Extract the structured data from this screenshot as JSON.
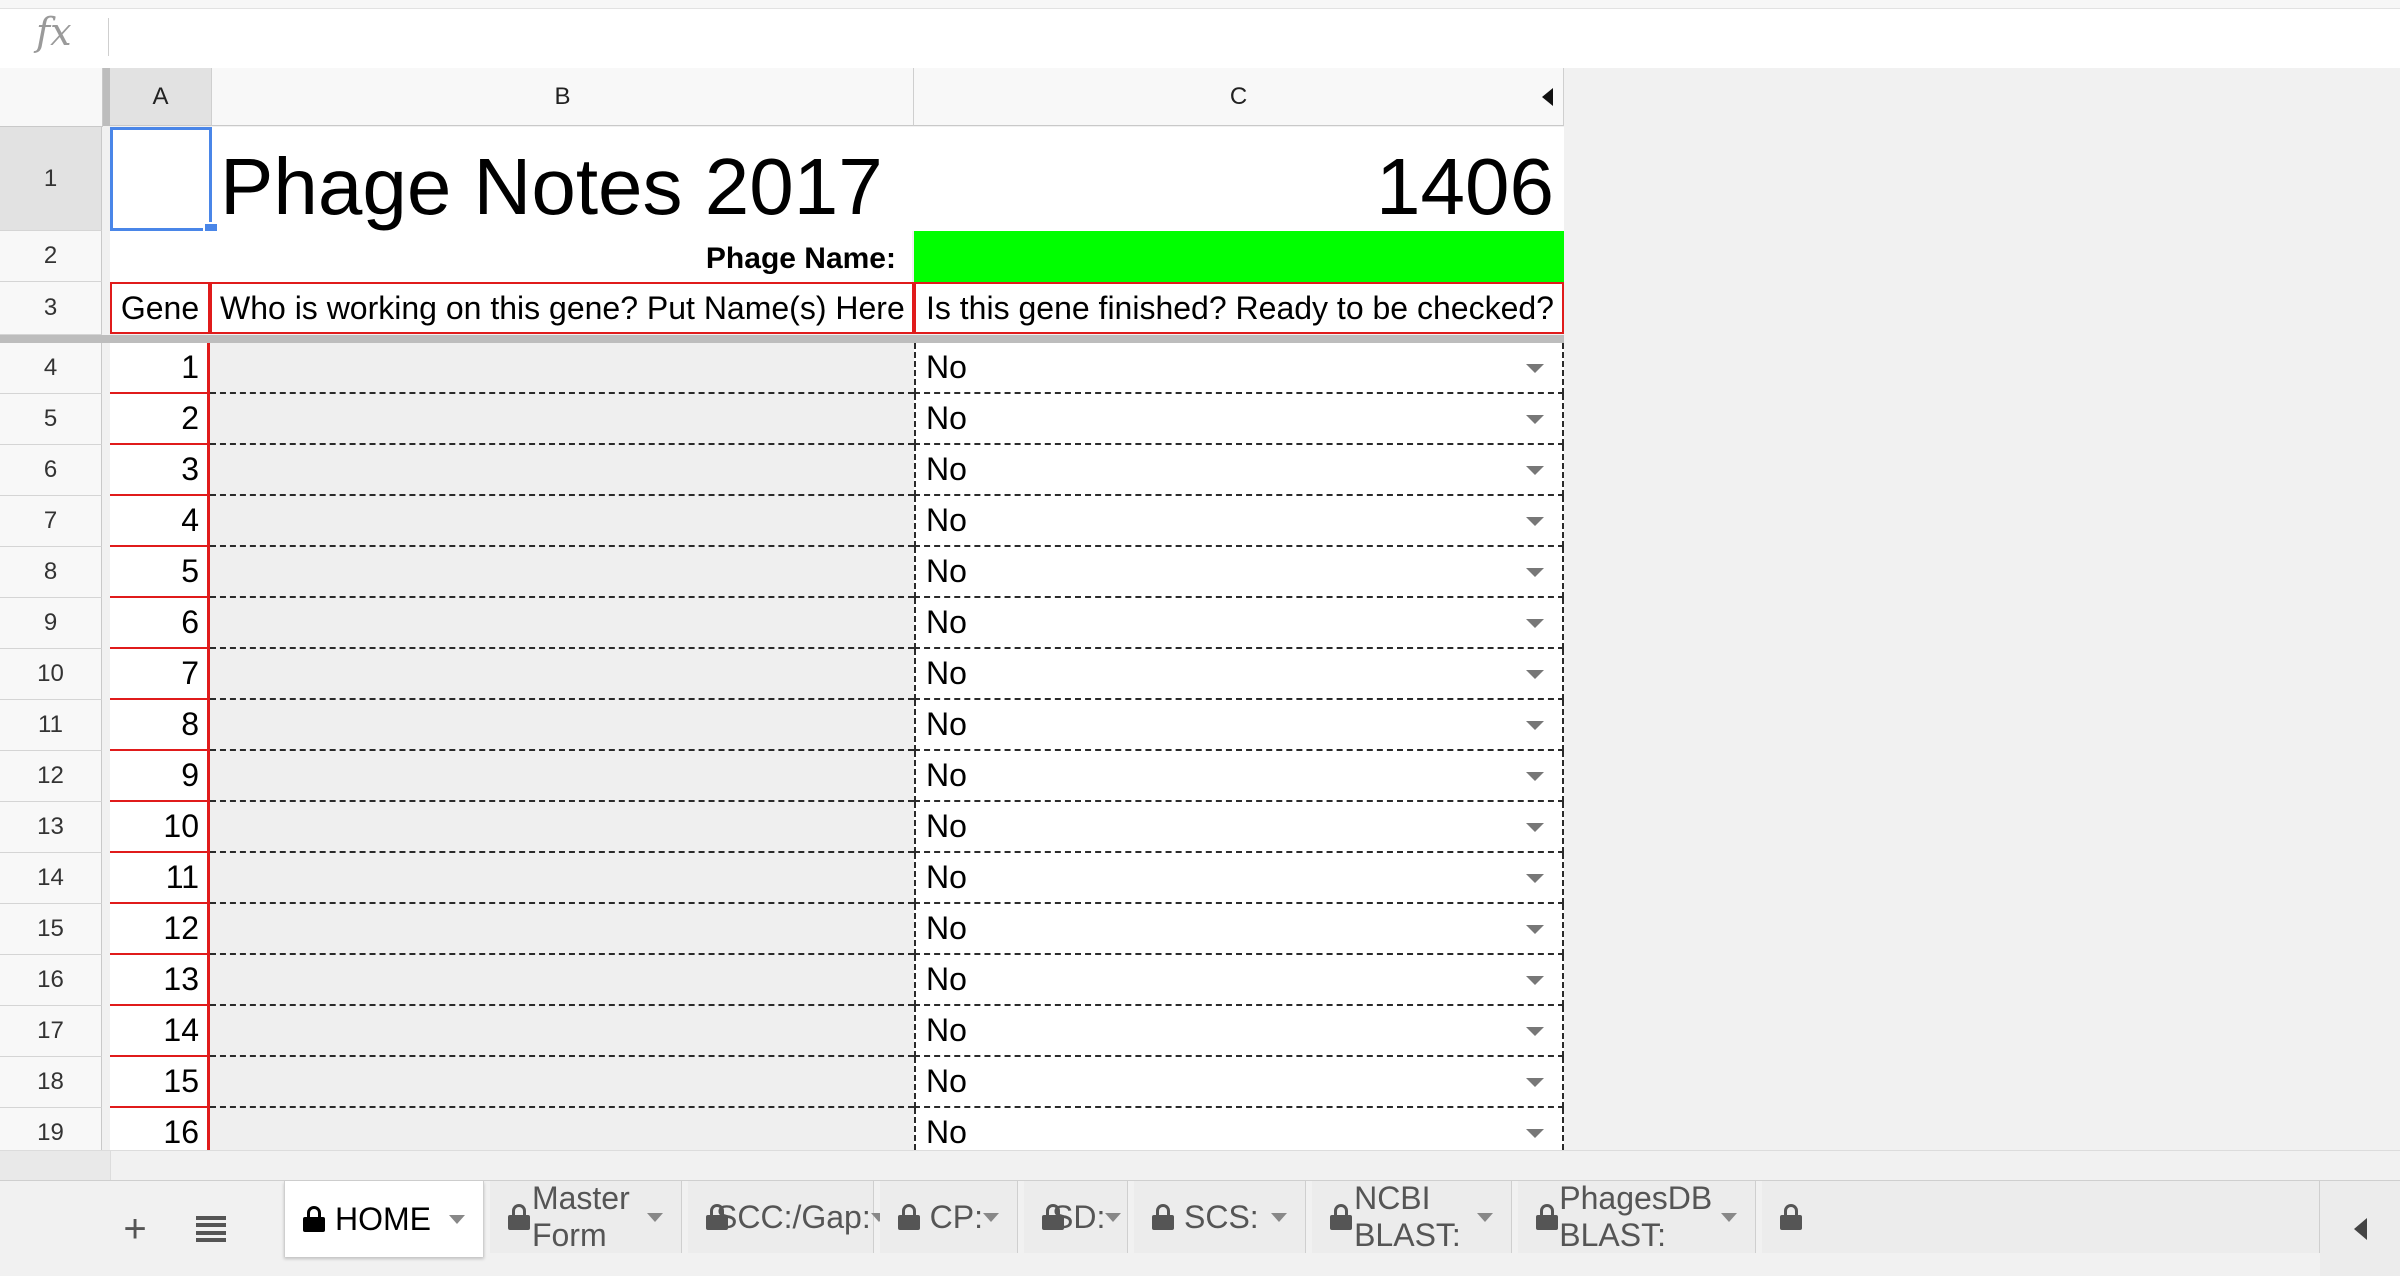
{
  "formula_bar": {
    "fx_label": "fx",
    "value": ""
  },
  "columns": [
    "A",
    "B",
    "C"
  ],
  "title": "Phage Notes 2017",
  "title_number": "1406",
  "phage_name_label": "Phage Name:",
  "phage_name_value": "",
  "headers": {
    "gene": "Gene",
    "who": "Who is working on this gene? Put Name(s) Here",
    "finished": "Is this gene finished? Ready to be checked?"
  },
  "row_numbers_top": [
    "1",
    "2",
    "3"
  ],
  "rows": [
    {
      "row": "4",
      "gene": "1",
      "who": "",
      "finished": "No"
    },
    {
      "row": "5",
      "gene": "2",
      "who": "",
      "finished": "No"
    },
    {
      "row": "6",
      "gene": "3",
      "who": "",
      "finished": "No"
    },
    {
      "row": "7",
      "gene": "4",
      "who": "",
      "finished": "No"
    },
    {
      "row": "8",
      "gene": "5",
      "who": "",
      "finished": "No"
    },
    {
      "row": "9",
      "gene": "6",
      "who": "",
      "finished": "No"
    },
    {
      "row": "10",
      "gene": "7",
      "who": "",
      "finished": "No"
    },
    {
      "row": "11",
      "gene": "8",
      "who": "",
      "finished": "No"
    },
    {
      "row": "12",
      "gene": "9",
      "who": "",
      "finished": "No"
    },
    {
      "row": "13",
      "gene": "10",
      "who": "",
      "finished": "No"
    },
    {
      "row": "14",
      "gene": "11",
      "who": "",
      "finished": "No"
    },
    {
      "row": "15",
      "gene": "12",
      "who": "",
      "finished": "No"
    },
    {
      "row": "16",
      "gene": "13",
      "who": "",
      "finished": "No"
    },
    {
      "row": "17",
      "gene": "14",
      "who": "",
      "finished": "No"
    },
    {
      "row": "18",
      "gene": "15",
      "who": "",
      "finished": "No"
    },
    {
      "row": "19",
      "gene": "16",
      "who": "",
      "finished": "No"
    }
  ],
  "sheet_tabs": [
    {
      "label": "HOME",
      "locked": true,
      "active": true
    },
    {
      "label": "Master Form",
      "locked": true,
      "active": false
    },
    {
      "label": "SCC:/Gap:",
      "locked": true,
      "active": false
    },
    {
      "label": "CP:",
      "locked": true,
      "active": false
    },
    {
      "label": "SD:",
      "locked": true,
      "active": false
    },
    {
      "label": "SCS:",
      "locked": true,
      "active": false
    },
    {
      "label": "NCBI BLAST:",
      "locked": true,
      "active": false
    },
    {
      "label": "PhagesDB BLAST:",
      "locked": true,
      "active": false
    }
  ],
  "colors": {
    "selection": "#4a86e8",
    "border_red": "#e01b1b",
    "phage_name_fill": "#00ff00"
  }
}
